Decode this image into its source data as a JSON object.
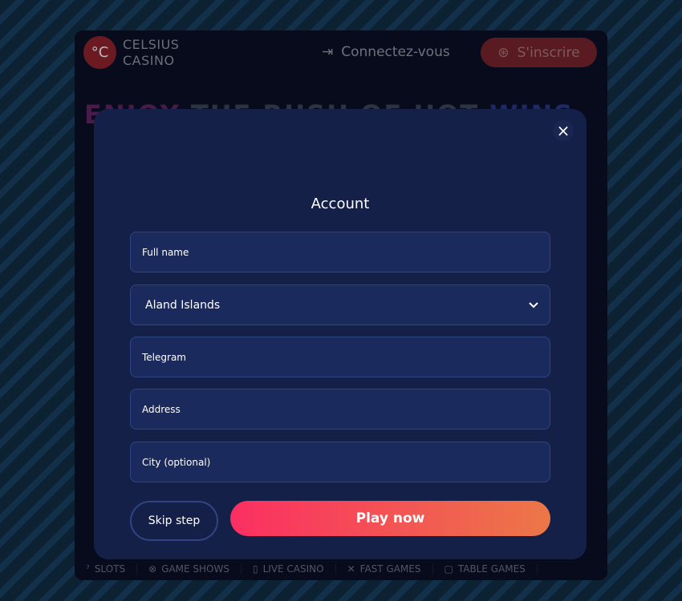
{
  "header": {
    "logo_mark": "°C",
    "logo_line1": "CELSIUS",
    "logo_line2": "CASINO",
    "login_label": "Connectez-vous",
    "signup_label": "S'inscrire"
  },
  "hero": {
    "part1": "ENJOY ",
    "part2": "THE RUSH OF HOT ",
    "part3": "WINS"
  },
  "bottom_nav": [
    {
      "label": "SLOTS"
    },
    {
      "label": "GAME SHOWS"
    },
    {
      "label": "LIVE CASINO"
    },
    {
      "label": "FAST GAMES"
    },
    {
      "label": "TABLE GAMES"
    }
  ],
  "modal": {
    "title": "Account",
    "close_icon": "×",
    "fields": {
      "full_name": "Full name",
      "country": "Aland Islands",
      "telegram": "Telegram",
      "address": "Address",
      "city": "City (optional)"
    },
    "skip_label": "Skip step",
    "play_label": "Play now"
  },
  "colors": {
    "accent_start": "#fb2f62",
    "accent_end": "#ec7747",
    "modal_bg": "#152049"
  }
}
